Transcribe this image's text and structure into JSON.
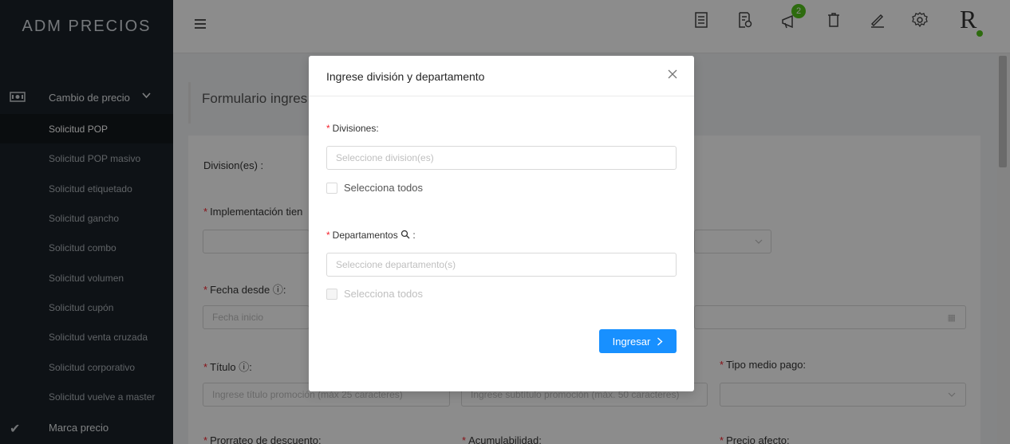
{
  "app": {
    "brand": "ADM PRECIOS"
  },
  "sidebar": {
    "parent_label": "Cambio de precio",
    "items": [
      {
        "label": "Solicitud POP"
      },
      {
        "label": "Solicitud POP masivo"
      },
      {
        "label": "Solicitud etiquetado"
      },
      {
        "label": "Solicitud gancho"
      },
      {
        "label": "Solicitud combo"
      },
      {
        "label": "Solicitud volumen"
      },
      {
        "label": "Solicitud cupón"
      },
      {
        "label": "Solicitud venta cruzada"
      },
      {
        "label": "Solicitud corporativo"
      },
      {
        "label": "Solicitud vuelve a master"
      }
    ],
    "marca_label": "Marca precio"
  },
  "topbar": {
    "badge_count": "2",
    "logo": "R"
  },
  "page": {
    "title": "Formulario ingres",
    "division_label": "Division(es) :",
    "impl_label": "Implementación tien",
    "fecha_label": "Fecha desde",
    "fecha_placeholder": "Fecha inicio",
    "titulo_label": "Título",
    "titulo_placeholder": "Ingrese título promoción (máx 25 caracteres)",
    "subtitulo_placeholder": "Ingrese subtítulo promoción (máx. 50 caracteres)",
    "tipo_medio_label": "Tipo medio pago",
    "prorrateo_label": "Prorrateo de descuento",
    "acumulabilidad_label": "Acumulabilidad",
    "precio_afecto_label": "Precio afecto"
  },
  "modal": {
    "title": "Ingrese división y departamento",
    "divisiones_label": "Divisiones",
    "divisiones_placeholder": "Seleccione division(es)",
    "selecciona_todos_1": "Selecciona todos",
    "departamentos_label": "Departamentos",
    "departamentos_placeholder": "Seleccione departamento(s)",
    "selecciona_todos_2": "Selecciona todos",
    "submit_label": "Ingresar"
  }
}
